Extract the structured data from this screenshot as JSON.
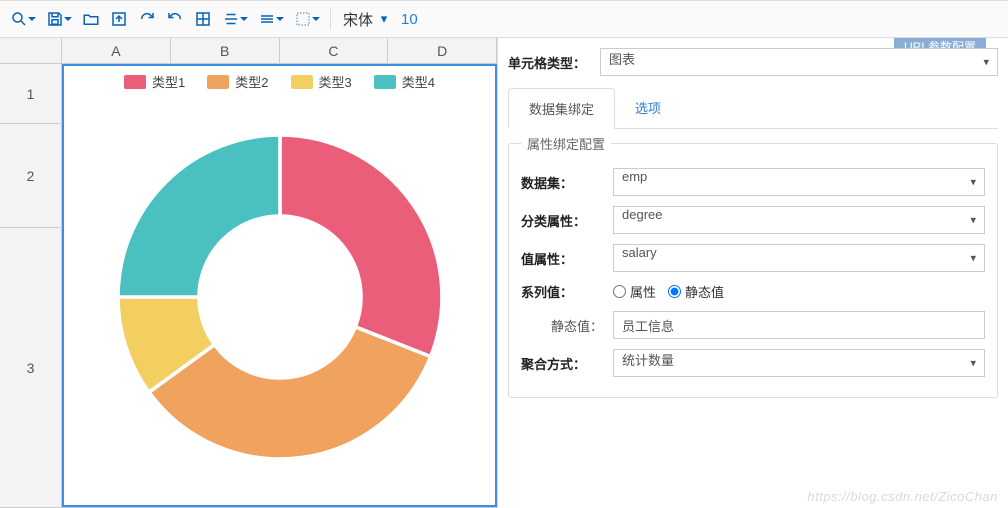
{
  "toolbar": {
    "font_name": "宋体",
    "font_size": "10"
  },
  "columns": [
    "A",
    "B",
    "C",
    "D"
  ],
  "rows": [
    "1",
    "2",
    "3"
  ],
  "chart_data": {
    "type": "pie",
    "title": "",
    "series": [
      {
        "name": "类型1",
        "value": 31,
        "color": "#eb5e7a"
      },
      {
        "name": "类型2",
        "value": 34,
        "color": "#f0a35e"
      },
      {
        "name": "类型3",
        "value": 10,
        "color": "#f3cf62"
      },
      {
        "name": "类型4",
        "value": 25,
        "color": "#4bc0c0"
      }
    ],
    "donut": true
  },
  "panel": {
    "cell_type_label": "单元格类型：",
    "cell_type_value": "图表",
    "tab_bind": "数据集绑定",
    "tab_options": "选项",
    "fieldset_title": "属性绑定配置",
    "dataset_label": "数据集：",
    "dataset_value": "emp",
    "category_label": "分类属性：",
    "category_value": "degree",
    "value_label": "值属性：",
    "value_value": "salary",
    "series_label": "系列值：",
    "radio_attr": "属性",
    "radio_static": "静态值",
    "static_label": "静态值：",
    "static_value": "员工信息",
    "agg_label": "聚合方式：",
    "agg_value": "统计数量"
  },
  "watermark": "https://blog.csdn.net/ZicoChan"
}
